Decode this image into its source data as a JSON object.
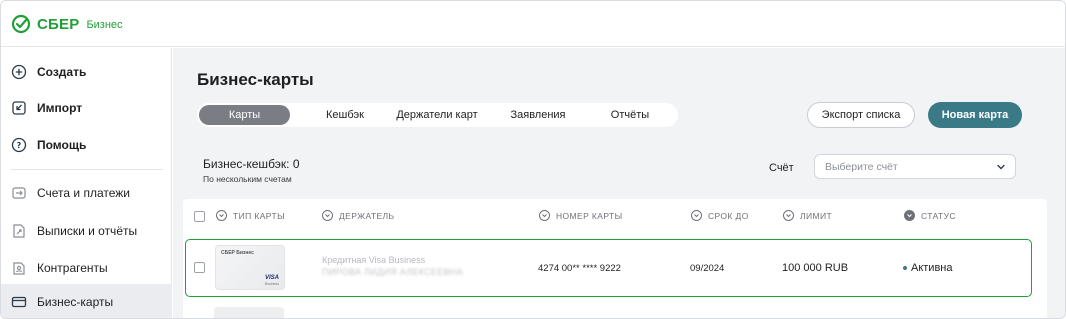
{
  "brand": {
    "name": "СБЕР",
    "sub": "Бизнес",
    "color": "#21a038"
  },
  "sidebar": {
    "items": [
      {
        "label": "Создать",
        "icon": "plus-circle-icon"
      },
      {
        "label": "Импорт",
        "icon": "import-icon"
      },
      {
        "label": "Помощь",
        "icon": "help-icon"
      },
      {
        "label": "Счета и платежи",
        "icon": "payments-icon"
      },
      {
        "label": "Выписки и отчёты",
        "icon": "reports-icon"
      },
      {
        "label": "Контрагенты",
        "icon": "contractors-icon"
      },
      {
        "label": "Бизнес-карты",
        "icon": "card-icon"
      }
    ]
  },
  "page": {
    "title": "Бизнес-карты",
    "tabs": [
      "Карты",
      "Кешбэк",
      "Держатели карт",
      "Заявления",
      "Отчёты"
    ],
    "active_tab": "Карты",
    "export_button": "Экспорт списка",
    "new_card_button": "Новая карта",
    "cashback": {
      "title": "Бизнес-кешбэк: 0",
      "subtitle": "По нескольким счетам"
    },
    "account": {
      "label": "Счёт",
      "placeholder": "Выберите счёт"
    }
  },
  "table": {
    "columns": [
      "Тип карты",
      "Держатель",
      "Номер карты",
      "Срок до",
      "Лимит",
      "Статус"
    ],
    "rows": [
      {
        "card_logo": "СБЕР Бизнес",
        "card_brand": "VISA",
        "card_brand_sub": "Business",
        "type": "Кредитная Visa Business",
        "holder": "ПИРОВА ЛИДИЯ АЛЕКСЕЕВНА",
        "number": "4274 00** **** 9222",
        "expiry": "09/2024",
        "limit": "100 000 RUB",
        "status": "Активна"
      }
    ]
  },
  "colors": {
    "accent": "#3a7a86",
    "active_tab": "#7a7e84",
    "selected_row_border": "#21a038"
  }
}
